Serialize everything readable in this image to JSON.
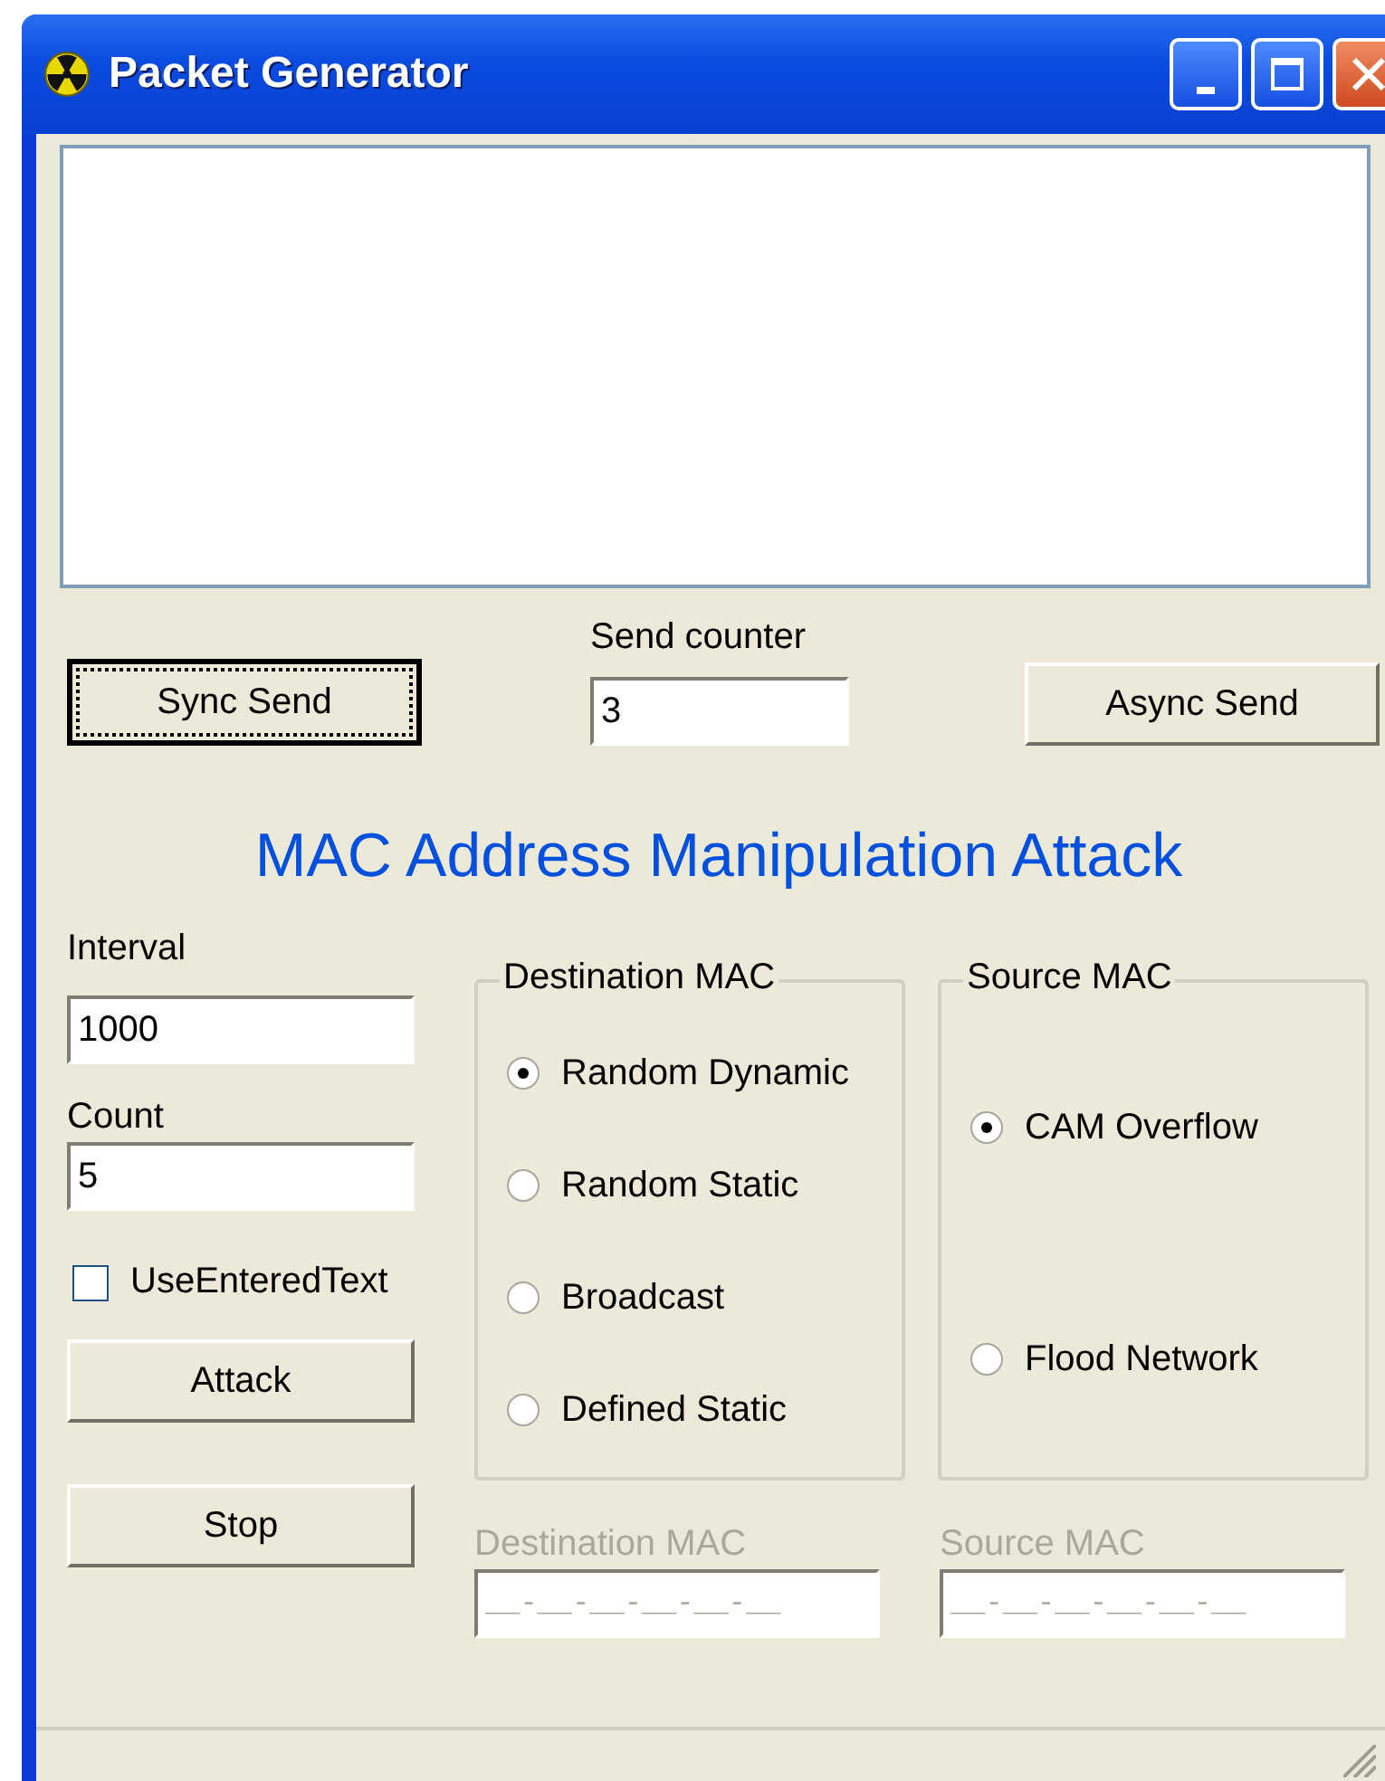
{
  "window": {
    "title": "Packet Generator"
  },
  "send_counter": {
    "label": "Send counter",
    "value": "3"
  },
  "sync_send": {
    "label": "Sync Send",
    "focused": true
  },
  "async_send": {
    "label": "Async Send",
    "focused": false
  },
  "heading": "MAC Address Manipulation Attack",
  "interval": {
    "label": "Interval",
    "value": "1000"
  },
  "count": {
    "label": "Count",
    "value": "5"
  },
  "use_entered_text": {
    "label": "UseEnteredText",
    "checked": false
  },
  "attack_button": {
    "label": "Attack"
  },
  "stop_button": {
    "label": "Stop"
  },
  "destination_mac_group": {
    "title": "Destination MAC",
    "options": [
      {
        "label": "Random Dynamic",
        "selected": true
      },
      {
        "label": "Random Static",
        "selected": false
      },
      {
        "label": "Broadcast",
        "selected": false
      },
      {
        "label": "Defined Static",
        "selected": false
      }
    ]
  },
  "source_mac_group": {
    "title": "Source MAC",
    "options": [
      {
        "label": "CAM Overflow",
        "selected": true
      },
      {
        "label": "Flood Network",
        "selected": false
      }
    ]
  },
  "mac_fields": [
    {
      "label": "Destination MAC",
      "value": "__-__-__-__-__-__",
      "disabled": true
    },
    {
      "label": "Source MAC",
      "value": "__-__-__-__-__-__",
      "disabled": true
    }
  ]
}
